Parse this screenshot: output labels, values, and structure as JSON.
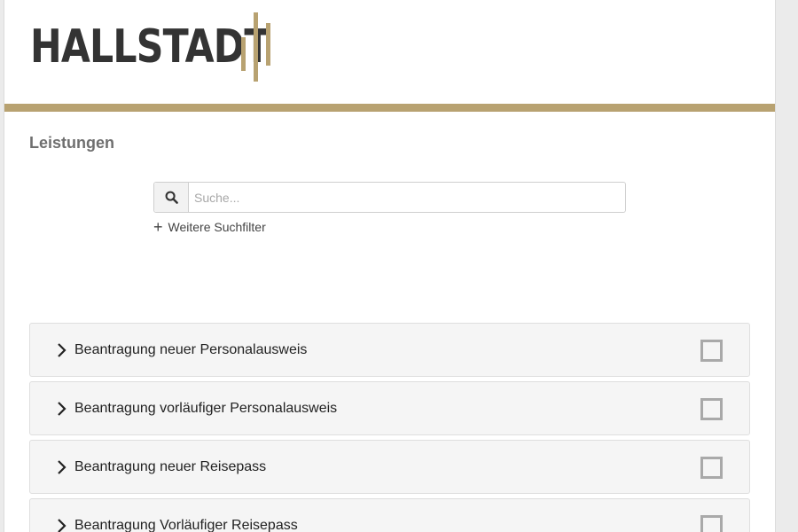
{
  "header": {
    "logo_text": "HALLSTADT",
    "brand_color": "#b8a271"
  },
  "section": {
    "title": "Leistungen"
  },
  "search": {
    "icon": "search-icon",
    "placeholder": "Suche...",
    "value": "",
    "more_filters_label": "Weitere Suchfilter"
  },
  "services": [
    {
      "label": "Beantragung neuer Personalausweis",
      "selected": false
    },
    {
      "label": "Beantragung vorläufiger Personalausweis",
      "selected": false
    },
    {
      "label": "Beantragung neuer Reisepass",
      "selected": false
    },
    {
      "label": "Beantragung Vorläufiger Reisepass",
      "selected": false
    }
  ]
}
